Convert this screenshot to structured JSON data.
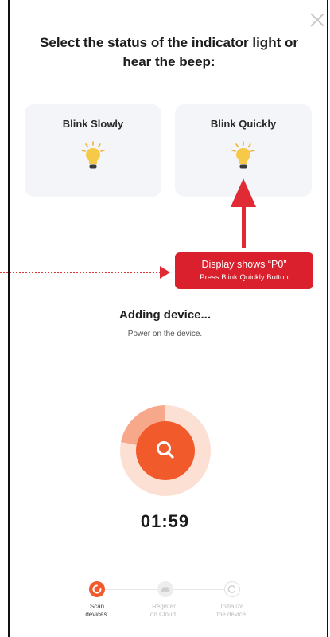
{
  "header": {
    "title": "Select the status of the indicator light or hear the beep:"
  },
  "options": [
    {
      "label": "Blink Slowly",
      "icon": "lightbulb-icon"
    },
    {
      "label": "Blink Quickly",
      "icon": "lightbulb-icon"
    }
  ],
  "callout": {
    "line1": "Display shows “P0”",
    "line2": "Press Blink Quickly Button"
  },
  "status": {
    "title": "Adding device...",
    "subtitle": "Power on the device.",
    "timer": "01:59"
  },
  "steps": [
    {
      "label_line1": "Scan",
      "label_line2": "devices.",
      "active": true
    },
    {
      "label_line1": "Register",
      "label_line2": "on Cloud.",
      "active": false
    },
    {
      "label_line1": "Initialize",
      "label_line2": "the device.",
      "active": false
    }
  ],
  "colors": {
    "accent": "#f15a2b",
    "annotation_red": "#d9202c",
    "card_bg": "#f3f5f9",
    "bulb": "#f7c948"
  }
}
